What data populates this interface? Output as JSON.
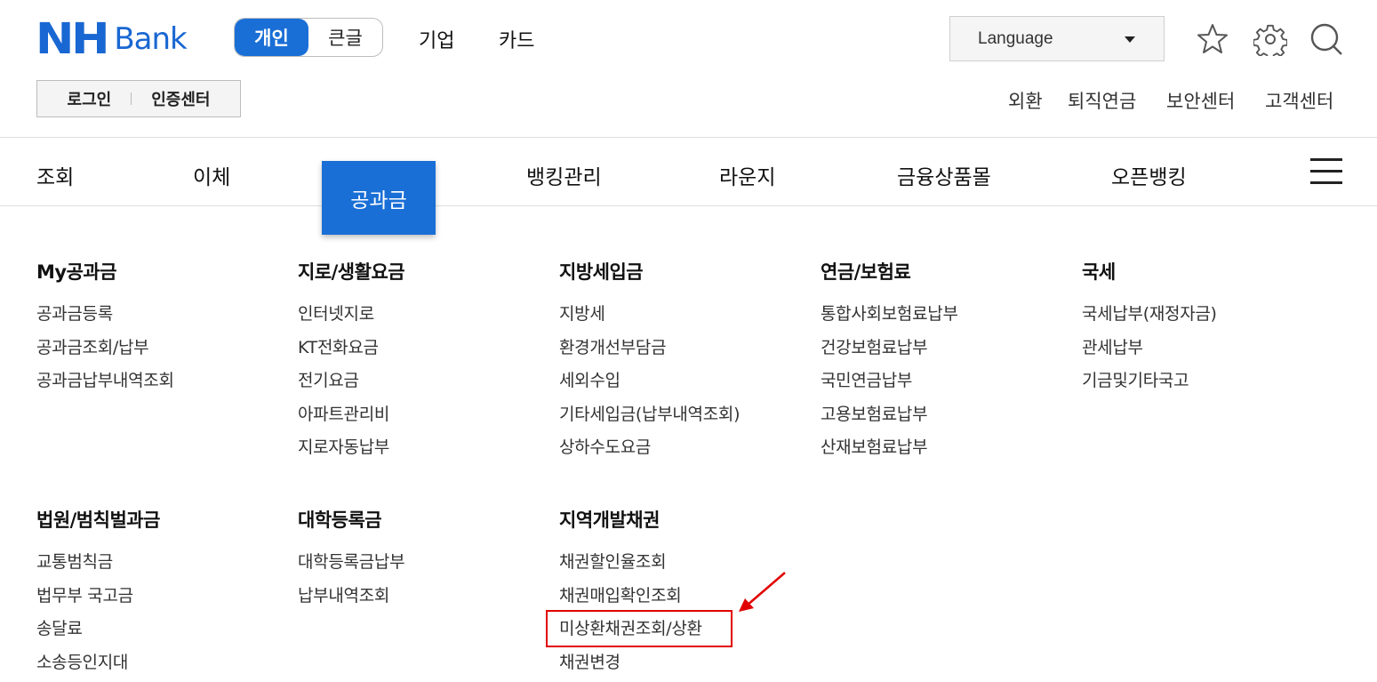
{
  "header": {
    "logo_nh": "NH",
    "logo_bank": "Bank",
    "segment": [
      {
        "label": "개인",
        "active": true
      },
      {
        "label": "큰글",
        "active": false
      }
    ],
    "top_nav": [
      "기업",
      "카드"
    ],
    "language": {
      "label": "Language"
    },
    "icons": [
      "star-icon",
      "gear-icon",
      "search-icon"
    ],
    "auth": {
      "login": "로그인",
      "cert": "인증센터"
    },
    "util_links": [
      "외환",
      "퇴직연금",
      "보안센터",
      "고객센터"
    ]
  },
  "gnb": {
    "items": [
      "조회",
      "이체",
      "공과금",
      "뱅킹관리",
      "라운지",
      "금융상품몰",
      "오픈뱅킹"
    ],
    "active": "공과금"
  },
  "mega_menu": {
    "columns": [
      {
        "title": "My공과금",
        "items": [
          "공과금등록",
          "공과금조회/납부",
          "공과금납부내역조회"
        ]
      },
      {
        "title": "지로/생활요금",
        "items": [
          "인터넷지로",
          "KT전화요금",
          "전기요금",
          "아파트관리비",
          "지로자동납부"
        ]
      },
      {
        "title": "지방세입금",
        "items": [
          "지방세",
          "환경개선부담금",
          "세외수입",
          "기타세입금(납부내역조회)",
          "상하수도요금"
        ]
      },
      {
        "title": "연금/보험료",
        "items": [
          "통합사회보험료납부",
          "건강보험료납부",
          "국민연금납부",
          "고용보험료납부",
          "산재보험료납부"
        ]
      },
      {
        "title": "국세",
        "items": [
          "국세납부(재정자금)",
          "관세납부",
          "기금및기타국고"
        ]
      },
      {
        "title": "법원/범칙벌과금",
        "items": [
          "교통범칙금",
          "법무부 국고금",
          "송달료",
          "소송등인지대"
        ]
      },
      {
        "title": "대학등록금",
        "items": [
          "대학등록금납부",
          "납부내역조회"
        ]
      },
      {
        "title": "지역개발채권",
        "items": [
          "채권할인율조회",
          "채권매입확인조회",
          "미상환채권조회/상환",
          "채권변경"
        ]
      }
    ]
  },
  "colors": {
    "brand": "#1967d2",
    "active_bg": "#1a6fd6",
    "annotation": "#e10000"
  }
}
